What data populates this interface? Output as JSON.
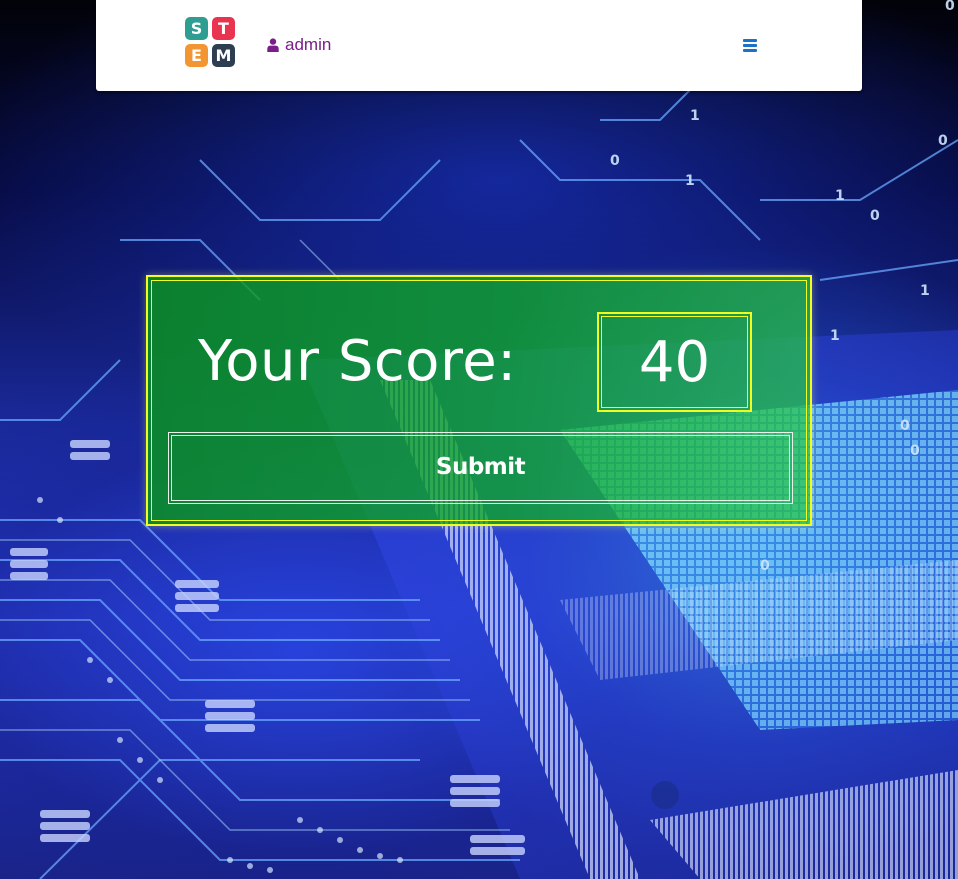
{
  "navbar": {
    "logo": {
      "letters": [
        "S",
        "T",
        "E",
        "M"
      ],
      "colors": [
        "#2e9e93",
        "#e8344f",
        "#f29533",
        "#2d3e50"
      ]
    },
    "user": {
      "icon": "user-icon",
      "name": "admin",
      "color": "#7b1c8a"
    },
    "menu": {
      "icon": "hamburger-menu-icon",
      "color": "#1a73c8"
    }
  },
  "score_panel": {
    "label": "Your Score:",
    "value": "40",
    "submit_label": "Submit",
    "border_color": "#f2ff1e",
    "panel_color": "#0ea824"
  },
  "background": {
    "description_icon": "circuit-board-background"
  }
}
